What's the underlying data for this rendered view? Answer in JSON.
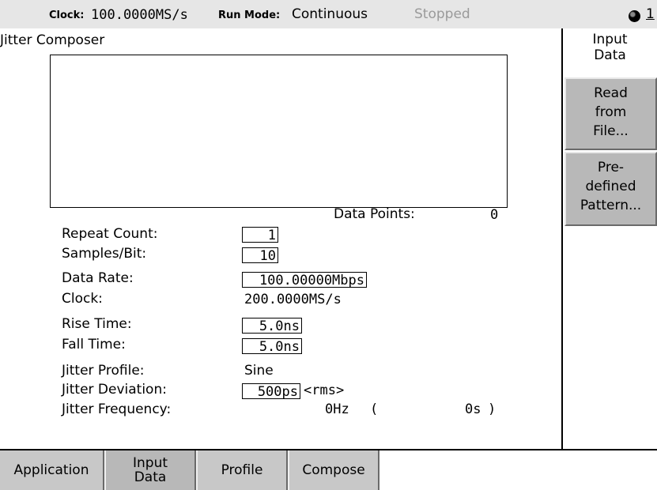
{
  "topbar": {
    "clock_label": "Clock:",
    "clock_value": "100.0000MS/s",
    "run_mode_label": "Run Mode:",
    "run_mode_value": "Continuous",
    "status": "Stopped",
    "page_number": "1",
    "knob_icon": "knob-icon"
  },
  "main": {
    "title": "Jitter Composer",
    "data_points_label": "Data Points:",
    "data_points_value": "0",
    "repeat_count_label": "Repeat Count:",
    "repeat_count_value": "1",
    "samples_per_bit_label": "Samples/Bit:",
    "samples_per_bit_value": "10",
    "data_rate_label": "Data Rate:",
    "data_rate_value": "100.00000Mbps",
    "clock_label": "Clock:",
    "clock_value": "200.0000MS/s",
    "rise_time_label": "Rise Time:",
    "rise_time_value": "5.0ns",
    "fall_time_label": "Fall Time:",
    "fall_time_value": "5.0ns",
    "jitter_profile_label": "Jitter Profile:",
    "jitter_profile_value": "Sine",
    "jitter_deviation_label": "Jitter Deviation:",
    "jitter_deviation_value": "500ps",
    "jitter_deviation_unit": "<rms>",
    "jitter_frequency_label": "Jitter Frequency:",
    "jitter_frequency_value": "0Hz",
    "jitter_frequency_open": "(",
    "jitter_period_value": "0s",
    "jitter_frequency_close": ")"
  },
  "side_panel": {
    "title_line1": "Input",
    "title_line2": "Data",
    "buttons": [
      {
        "lines": [
          "Read",
          "from",
          "File..."
        ]
      },
      {
        "lines": [
          "Pre-",
          "defined",
          "Pattern..."
        ]
      }
    ]
  },
  "bottom_tabs": [
    {
      "label": "Application"
    },
    {
      "label_line1": "Input",
      "label_line2": "Data"
    },
    {
      "label": "Profile"
    },
    {
      "label": "Compose"
    }
  ]
}
